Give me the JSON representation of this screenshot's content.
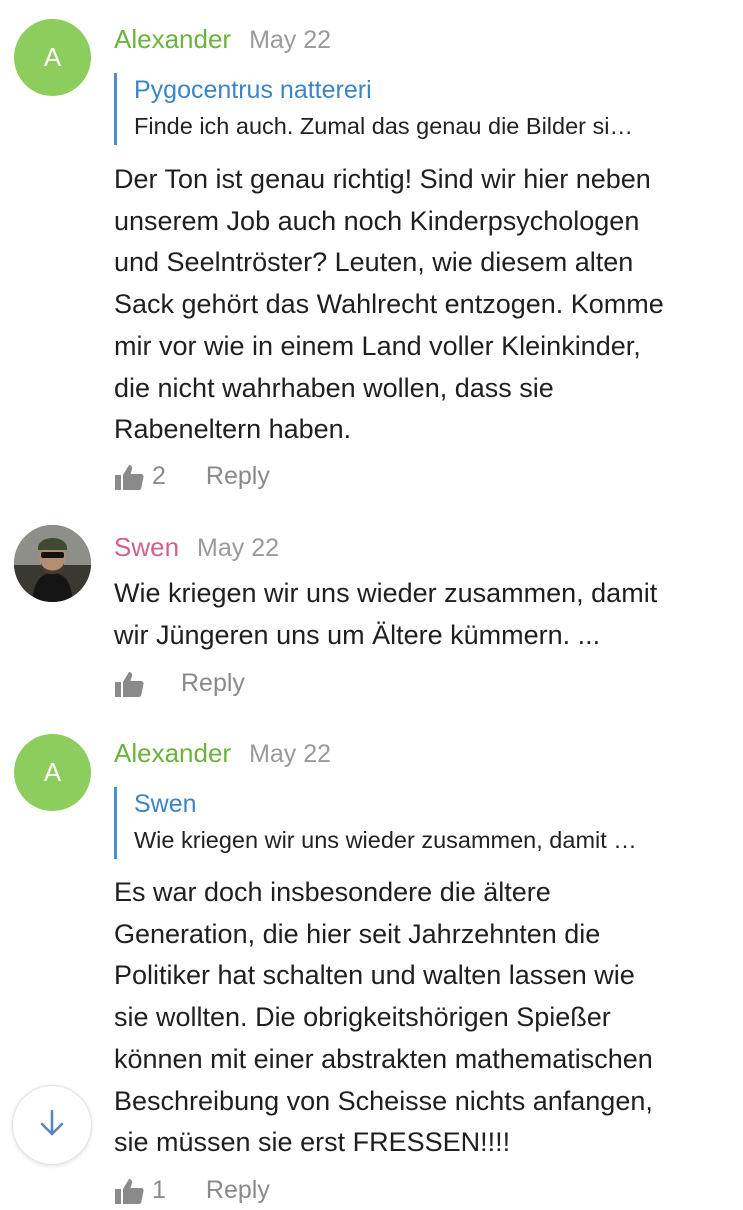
{
  "comments": [
    {
      "avatar_letter": "A",
      "author": "Alexander",
      "date": "May 22",
      "quote": {
        "author": "Pygocentrus nattereri",
        "text": "Finde ich auch. Zumal das genau die Bilder si…"
      },
      "lines": [
        "Der Ton ist genau richtig! Sind wir hier neben",
        "unserem Job auch noch Kinderpsychologen",
        "und Seelntröster? Leuten, wie diesem alten",
        "Sack gehört das Wahlrecht entzogen. Komme",
        "mir vor wie in einem Land voller Kleinkinder,",
        "die nicht wahrhaben wollen, dass sie",
        "Rabeneltern haben."
      ],
      "likes": "2",
      "reply_label": "Reply"
    },
    {
      "author": "Swen",
      "date": "May 22",
      "lines": [
        "Wie kriegen wir uns wieder zusammen, damit",
        "wir Jüngeren uns um Ältere kümmern. ..."
      ],
      "reply_label": "Reply"
    },
    {
      "avatar_letter": "A",
      "author": "Alexander",
      "date": "May 22",
      "quote": {
        "author": "Swen",
        "text": "Wie kriegen wir uns wieder zusammen, damit …"
      },
      "lines": [
        "Es war doch insbesondere die ältere",
        "Generation, die hier seit Jahrzehnten die",
        "Politiker hat schalten und walten lassen wie",
        "sie wollten. Die obrigkeitshörigen Spießer",
        "können mit einer abstrakten mathematischen",
        "Beschreibung von Scheisse nichts anfangen,",
        "sie müssen sie erst FRESSEN!!!!"
      ],
      "likes": "1",
      "reply_label": "Reply"
    }
  ],
  "colors": {
    "author_green": "#6cb33e",
    "author_pink": "#d46086",
    "quote_author": "#3b84c8",
    "quote_bar": "#4a8fd0",
    "avatar_green": "#8ccd5e",
    "meta_gray": "#9a9a9a"
  },
  "icons": {
    "like": "thumbs-up-icon",
    "scroll_down": "arrow-down-icon"
  }
}
